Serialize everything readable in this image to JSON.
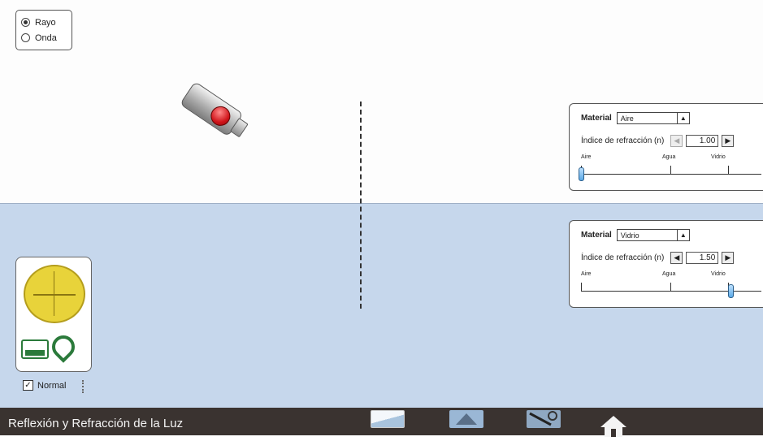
{
  "mode": {
    "options": [
      {
        "label": "Rayo",
        "selected": true
      },
      {
        "label": "Onda",
        "selected": false
      }
    ]
  },
  "top_panel": {
    "material_label": "Material",
    "material_value": "Aire",
    "index_label": "Índice de refracción (n)",
    "index_value": "1.00",
    "ticks": [
      "Aire",
      "Agua",
      "Vidrio"
    ],
    "slider_fraction": 0.0
  },
  "bottom_panel": {
    "material_label": "Material",
    "material_value": "Vidrio",
    "index_label": "Índice de refracción (n)",
    "index_value": "1.50",
    "ticks": [
      "Aire",
      "Agua",
      "Vidrio"
    ],
    "slider_fraction": 0.83
  },
  "toolbox": {
    "normal_label": "Normal",
    "normal_checked": true
  },
  "navbar": {
    "title": "Reflexión y Refracción de la Luz",
    "tabs": [
      {
        "icon": "intro-tab-icon",
        "selected": true
      },
      {
        "icon": "prisms-tab-icon",
        "selected": false
      },
      {
        "icon": "more-tools-tab-icon",
        "selected": false
      }
    ],
    "home_icon": "home-icon"
  },
  "colors": {
    "air_bg": "#fdfdfd",
    "glass_bg": "#c6d7ec",
    "navbar_bg": "#3a3330",
    "laser_button": "#d0141a",
    "tool_green": "#2b7a3b",
    "protractor_yellow": "#e8d33a"
  }
}
